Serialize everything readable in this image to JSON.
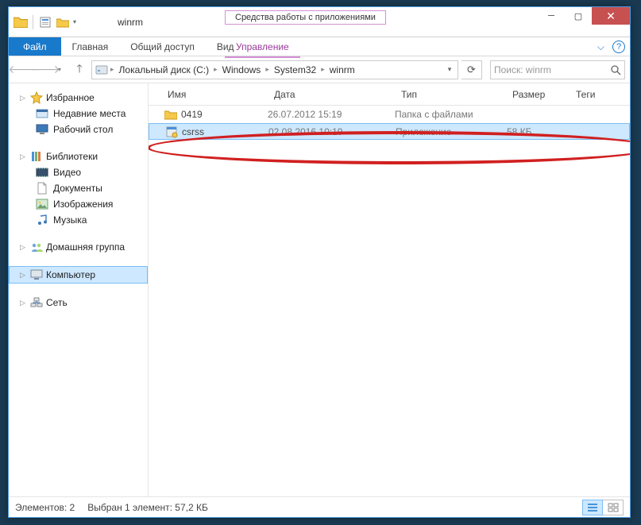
{
  "window": {
    "title": "winrm",
    "context_tab": "Средства работы с приложениями",
    "context_sub": "Управление"
  },
  "ribbon": {
    "file": "Файл",
    "tabs": [
      "Главная",
      "Общий доступ",
      "Вид"
    ]
  },
  "nav": {
    "breadcrumbs": [
      "Локальный диск (C:)",
      "Windows",
      "System32",
      "winrm"
    ],
    "search_placeholder": "Поиск: winrm"
  },
  "sidebar": {
    "favorites": {
      "label": "Избранное",
      "items": [
        "Недавние места",
        "Рабочий стол"
      ]
    },
    "libraries": {
      "label": "Библиотеки",
      "items": [
        "Видео",
        "Документы",
        "Изображения",
        "Музыка"
      ]
    },
    "homegroup": {
      "label": "Домашняя группа"
    },
    "computer": {
      "label": "Компьютер"
    },
    "network": {
      "label": "Сеть"
    }
  },
  "columns": {
    "name": "Имя",
    "date": "Дата",
    "type": "Тип",
    "size": "Размер",
    "tags": "Теги"
  },
  "rows": [
    {
      "name": "0419",
      "date": "26.07.2012 15:19",
      "type": "Папка с файлами",
      "size": "",
      "selected": false,
      "icon": "folder"
    },
    {
      "name": "csrss",
      "date": "02.08.2016 10:19",
      "type": "Приложение",
      "size": "58 КБ",
      "selected": true,
      "icon": "exe"
    }
  ],
  "status": {
    "count_label": "Элементов: 2",
    "selection_label": "Выбран 1 элемент: 57,2 КБ"
  }
}
